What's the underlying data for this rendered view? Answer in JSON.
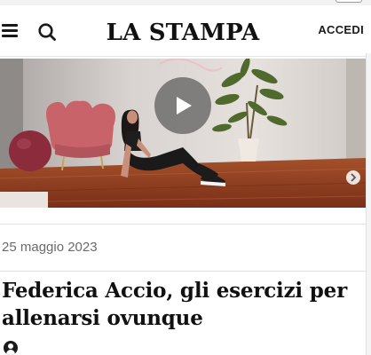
{
  "header": {
    "logo_text": "LA STAMPA",
    "login_label": "ACCEDI",
    "menu_icon": "hamburger-menu-icon",
    "search_icon": "search-icon"
  },
  "video": {
    "play_icon": "play-icon",
    "next_icon": "chevron-right-icon"
  },
  "article": {
    "date": "25 maggio 2023",
    "title": "Federica Accio, gli esercizi per allenarsi ovunque",
    "author_icon": "user-avatar-icon"
  },
  "colors": {
    "background": "#ffffff",
    "text": "#111111",
    "date_text": "#6b6b6b",
    "floor": "#8a3b1f",
    "chair": "#c9636a",
    "ball": "#8b2b3b"
  }
}
